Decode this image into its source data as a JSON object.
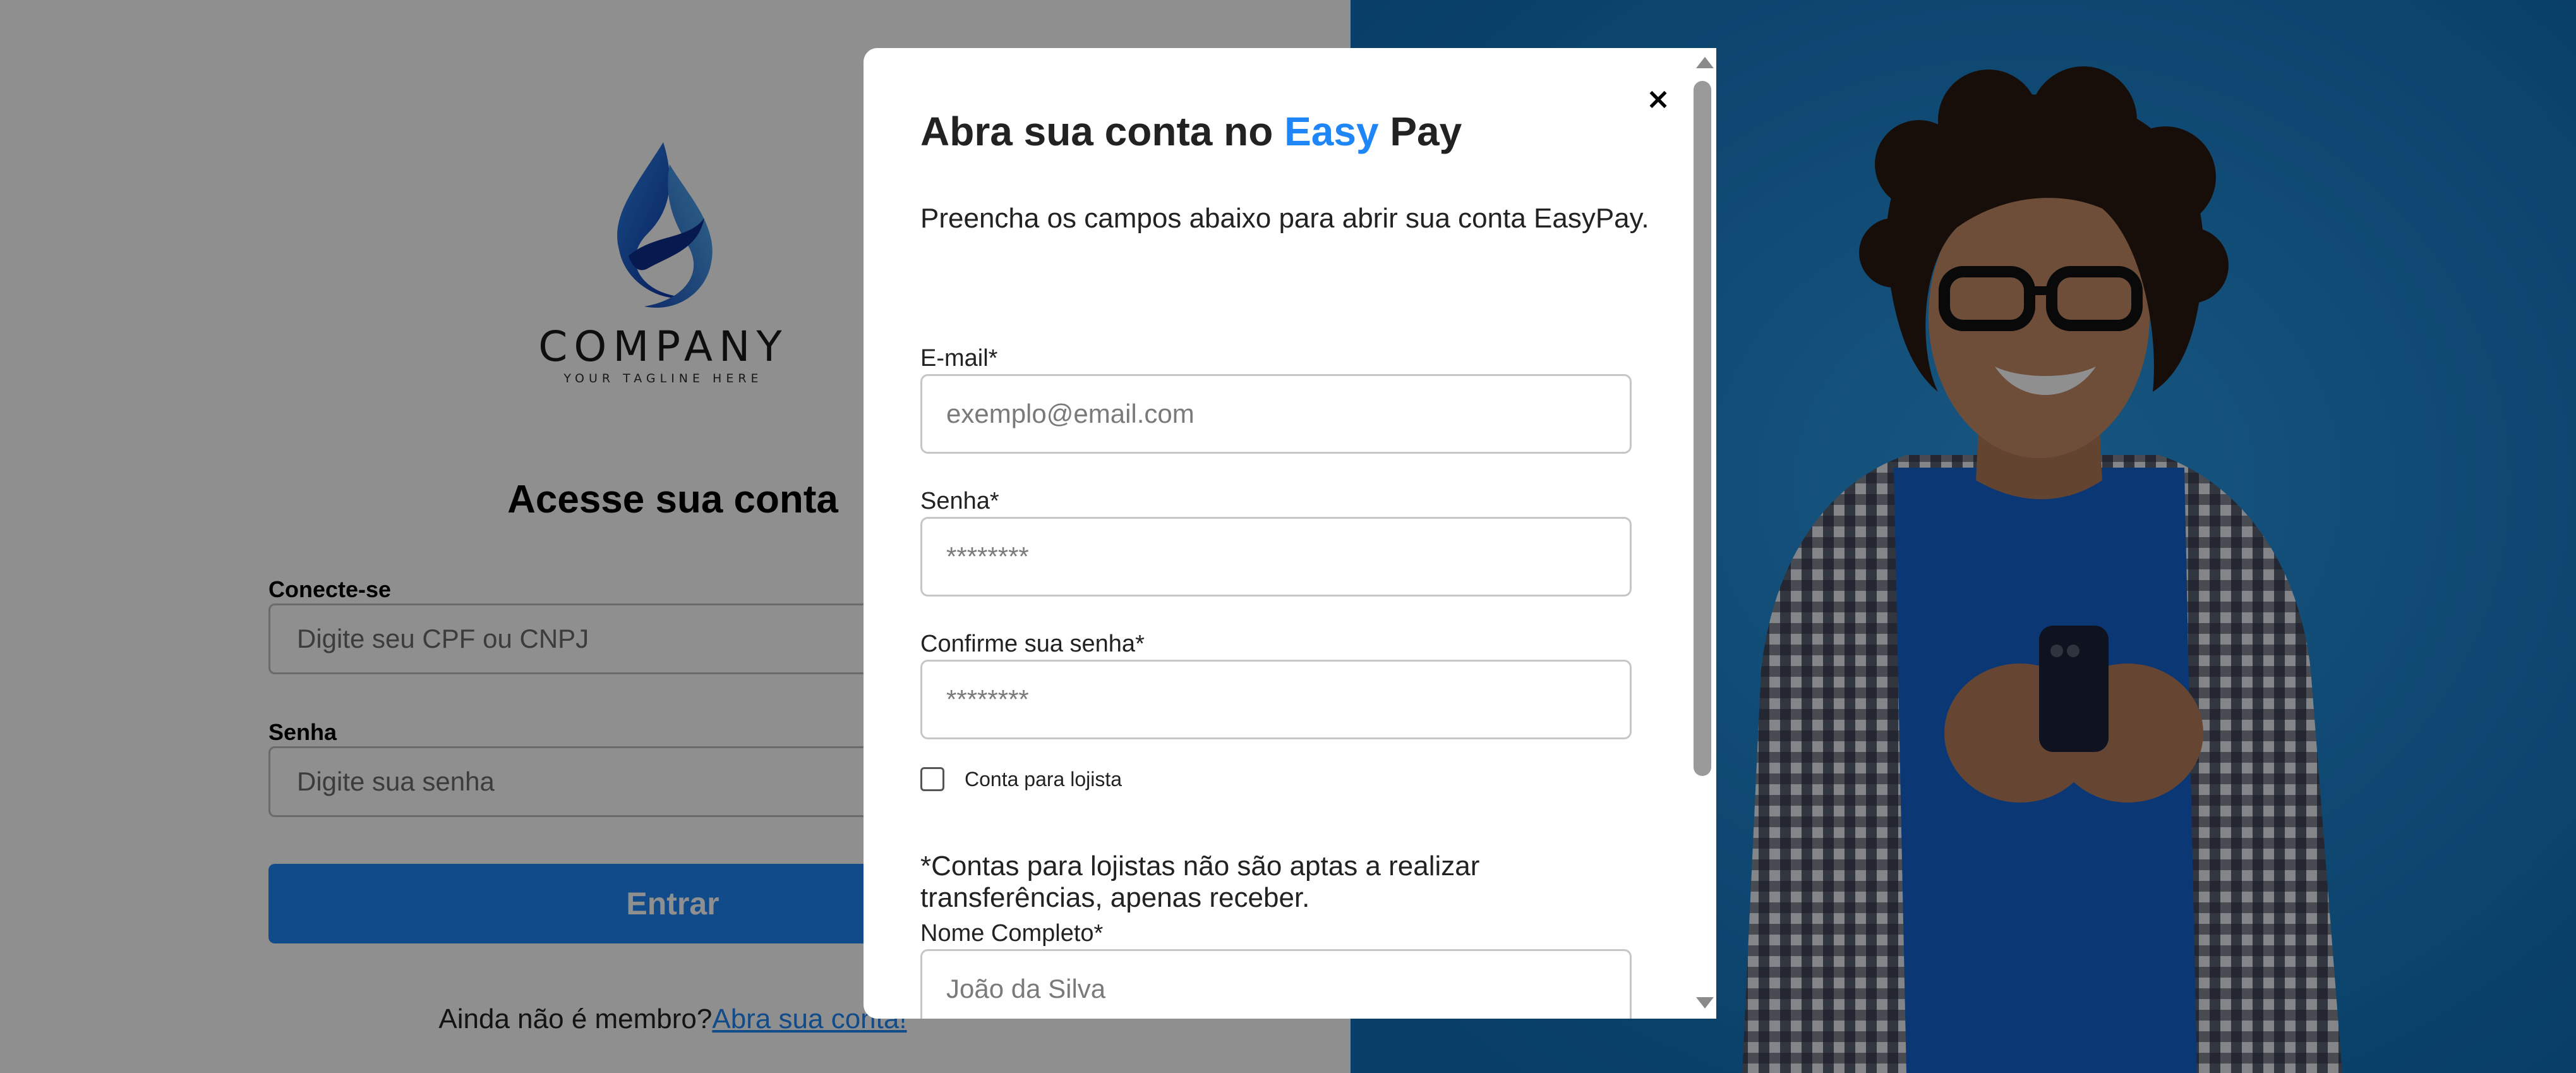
{
  "login": {
    "logo_name": "COMPANY",
    "logo_tagline": "YOUR TAGLINE HERE",
    "title": "Acesse sua conta",
    "connect_label": "Conecte-se",
    "connect_placeholder": "Digite seu CPF ou CNPJ",
    "password_label": "Senha",
    "password_placeholder": "Digite sua senha",
    "submit_label": "Entrar",
    "signup_prompt": "Ainda não é membro?",
    "signup_link": "Abra sua conta!"
  },
  "modal": {
    "close_label": "×",
    "title_prefix": "Abra sua conta no ",
    "title_brand": "Easy",
    "title_suffix": " Pay",
    "subtitle": "Preencha os campos abaixo para abrir sua conta EasyPay.",
    "email_label": "E-mail*",
    "email_placeholder": "exemplo@email.com",
    "password_label": "Senha*",
    "password_placeholder": "********",
    "confirm_label": "Confirme sua senha*",
    "confirm_placeholder": "********",
    "merchant_checkbox_label": "Conta para lojista",
    "merchant_checked": false,
    "merchant_notice": "*Contas para lojistas não são aptas a realizar transferências, apenas receber.",
    "fullname_label": "Nome Completo*",
    "fullname_placeholder": "João da Silva"
  },
  "colors": {
    "brand_blue": "#1f86f7",
    "hero_background": "#1f86d6",
    "overlay": "rgba(0,0,0,0.44)"
  },
  "icons": {
    "logo": "company-flame-logo",
    "close": "close-icon",
    "scroll_up": "scroll-up-arrow-icon",
    "scroll_down": "scroll-down-arrow-icon"
  }
}
